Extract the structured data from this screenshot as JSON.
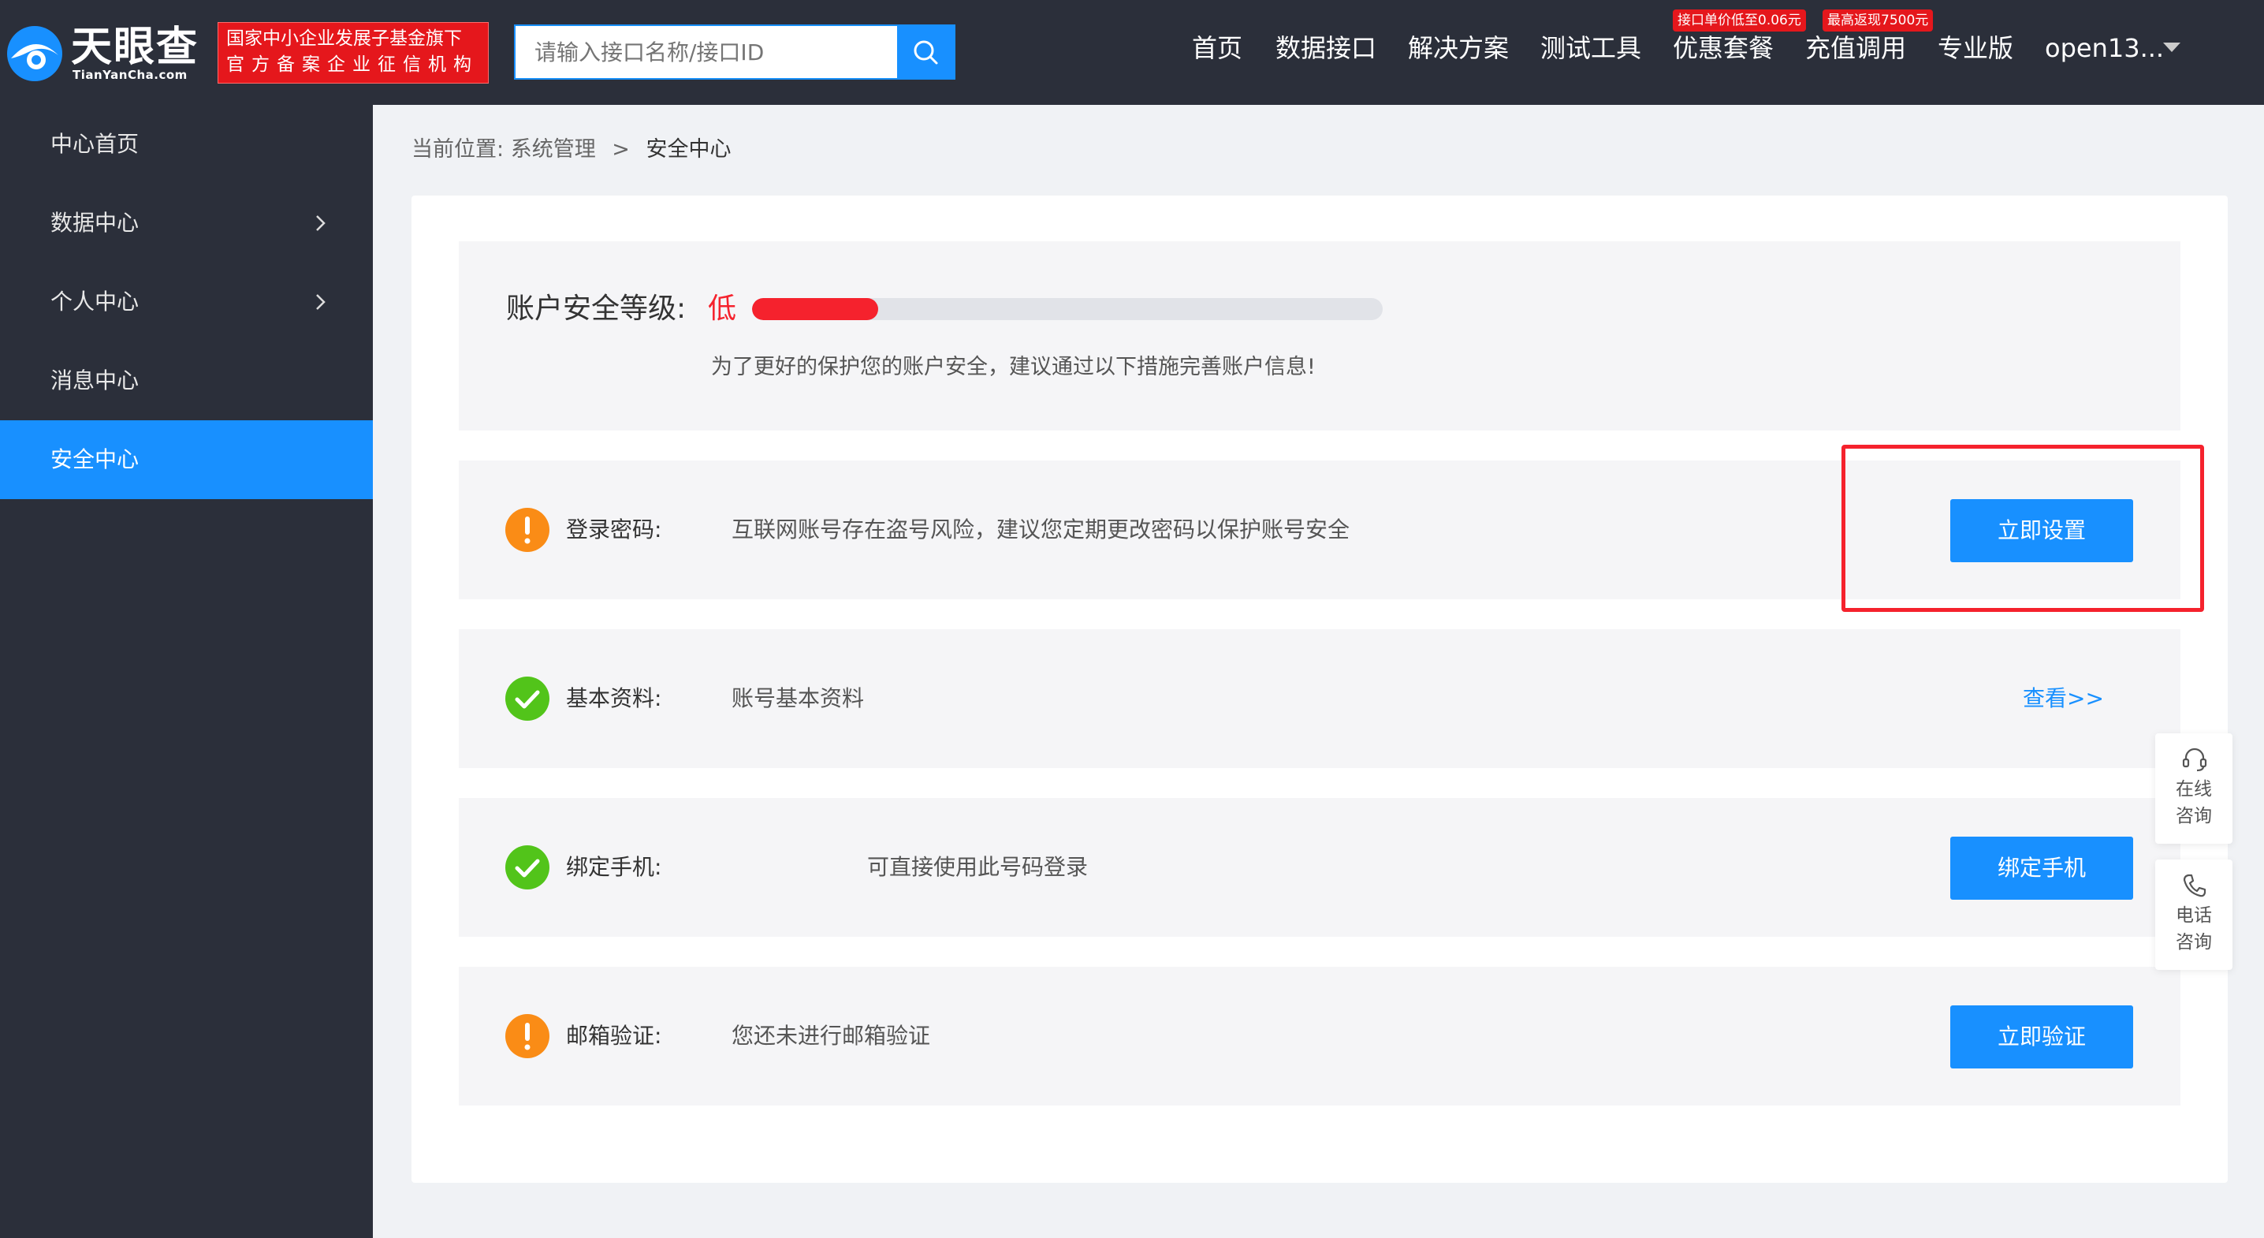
{
  "header": {
    "logo_text": "天眼查",
    "logo_domain": "TianYanCha.com",
    "org_badge_line1": "国家中小企业发展子基金旗下",
    "org_badge_line2": "官方备案企业征信机构",
    "search_placeholder": "请输入接口名称/接口ID",
    "nav": [
      "首页",
      "数据接口",
      "解决方案",
      "测试工具",
      "优惠套餐",
      "充值调用",
      "专业版"
    ],
    "nav_tags": [
      "接口单价低至0.06元",
      "最高返现7500元"
    ],
    "user": "open13..."
  },
  "sidebar": {
    "items": [
      {
        "label": "中心首页"
      },
      {
        "label": "数据中心"
      },
      {
        "label": "个人中心"
      },
      {
        "label": "消息中心"
      },
      {
        "label": "安全中心"
      }
    ],
    "active_index": 4
  },
  "breadcrumb": {
    "prefix": "当前位置:",
    "parent": "系统管理",
    "separator": ">",
    "current": "安全中心"
  },
  "security_level": {
    "label": "账户安全等级:",
    "value": "低",
    "progress": 0.2,
    "tip": "为了更好的保护您的账户安全，建议通过以下措施完善账户信息!"
  },
  "items": [
    {
      "status": "warning",
      "label": "登录密码:",
      "desc": "互联网账号存在盗号风险，建议您定期更改密码以保护账号安全",
      "action": "立即设置",
      "action_type": "button"
    },
    {
      "status": "ok",
      "label": "基本资料:",
      "desc": "账号基本资料",
      "action": "查看>>",
      "action_type": "link"
    },
    {
      "status": "ok",
      "label": "绑定手机:",
      "desc": "可直接使用此号码登录",
      "action": "绑定手机",
      "action_type": "button"
    },
    {
      "status": "warning",
      "label": "邮箱验证:",
      "desc": "您还未进行邮箱验证",
      "action": "立即验证",
      "action_type": "button"
    }
  ],
  "float": {
    "online_consult": "在线\n咨询",
    "phone_consult": "电话\n咨询"
  },
  "colors": {
    "header_bg": "#2b2f3a",
    "accent": "#1890ff",
    "danger": "#f5222d",
    "warning": "#fa8c16",
    "success": "#52c41a"
  }
}
